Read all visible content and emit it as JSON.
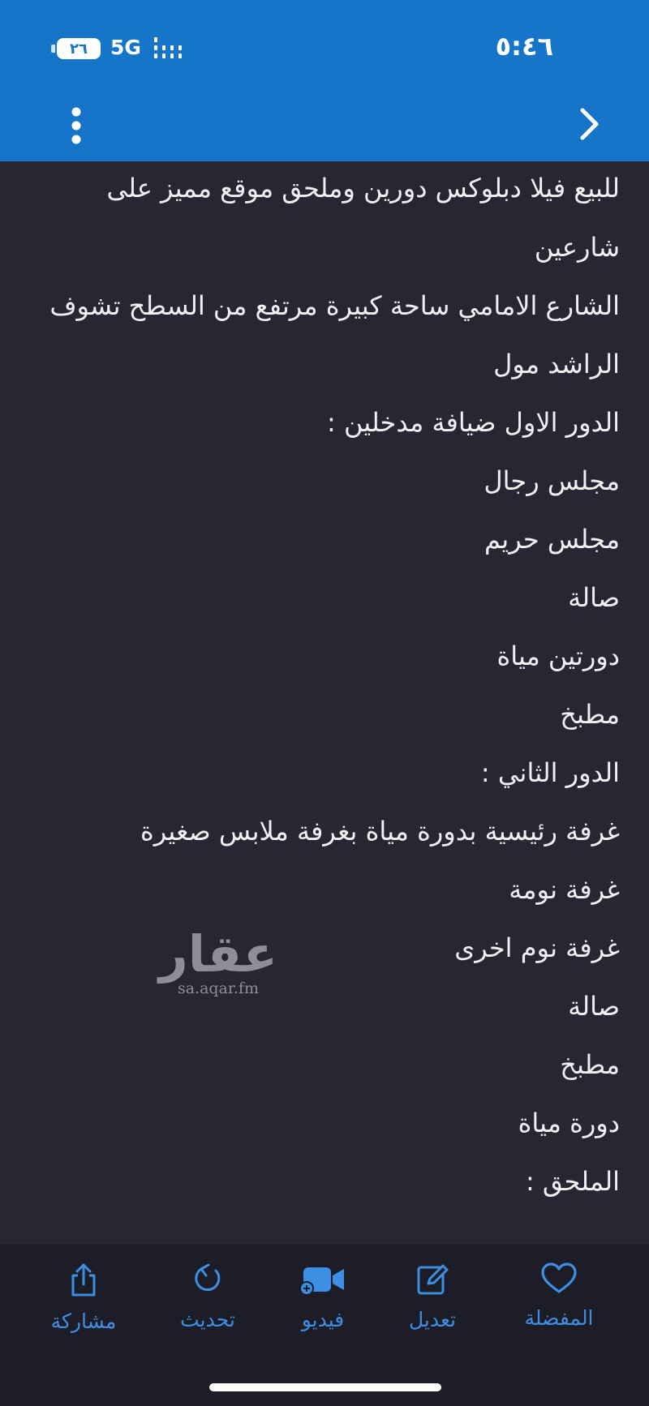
{
  "status_bar": {
    "time": "٥:٤٦",
    "battery": "٢٦",
    "network": "5G"
  },
  "nav": {
    "back_icon": "chevron-right-icon",
    "menu_icon": "more-vertical-icon"
  },
  "content": {
    "lines": [
      "للبيع فيلا دبلوكس دورين وملحق موقع مميز على",
      "شارعين",
      "الشارع الامامي ساحة كبيرة مرتفع من السطح تشوف",
      "الراشد مول",
      "الدور الاول ضيافة مدخلين :",
      "مجلس رجال",
      "مجلس حريم",
      "صالة",
      "دورتين مياة",
      "مطبخ",
      "الدور الثاني :",
      "غرفة رئيسية بدورة مياة بغرفة ملابس صغيرة",
      "غرفة نومة",
      "غرفة نوم اخرى",
      "صالة",
      "مطبخ",
      "دورة مياة",
      "الملحق :"
    ]
  },
  "watermark": {
    "logo": "عقار",
    "url": "sa.aqar.fm"
  },
  "tabbar": {
    "items": [
      {
        "label": "المفضلة",
        "icon": "heart-icon"
      },
      {
        "label": "تعديل",
        "icon": "edit-icon"
      },
      {
        "label": "فيديو",
        "icon": "video-icon"
      },
      {
        "label": "تحديث",
        "icon": "refresh-icon"
      },
      {
        "label": "مشاركة",
        "icon": "share-icon"
      }
    ]
  },
  "colors": {
    "header": "#1675c8",
    "background": "#262733",
    "tabbar": "#1c1d26",
    "accent": "#3d8fe3",
    "text": "#f1f1f3"
  }
}
